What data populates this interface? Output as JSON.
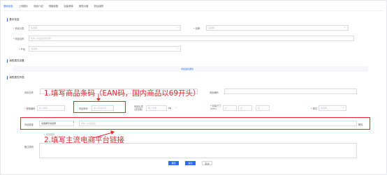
{
  "tabs": [
    "基础信息",
    "上传图片",
    "商品介绍",
    "规格参数",
    "包装清单",
    "销售价格",
    "售后保障"
  ],
  "sections": {
    "basic": "基本信息",
    "sales_attr": "销售属性设置",
    "sales_list": "销售属性列表"
  },
  "basic": {
    "category_label": "商品分类",
    "category_placeholder": "请选择",
    "brand_label": "品牌",
    "brand_placeholder": "请选择",
    "name_label": "商品名称",
    "name_placeholder": "请输入商品名称(标题)",
    "origin_label": "产地",
    "origin_placeholder": "请选择"
  },
  "sales_attr": {
    "add_link": "添加销售属性"
  },
  "sales_list": {
    "product_name_label": "商品名称",
    "product_code_label": "商品编码",
    "spec_code_label": "规格编码",
    "spec_code_placeholder": "输入编码",
    "barcode_label": "商品条码",
    "barcode_placeholder": "输入商品条码",
    "weight_label": "商品毛重(含包装)",
    "weight_placeholder": "输入毛重",
    "weight_unit": "kg",
    "dims_label": "包装尺寸(mm)",
    "dims_l": "长",
    "dims_w": "宽",
    "dims_h": "高",
    "unit_label": "单位",
    "unit_placeholder": "请选择",
    "link_label": "商品链接",
    "platform_value": "请选择平台名称",
    "link_placeholder": "请输入商品链接",
    "delete": "删除",
    "add_link": "+ 添加链接",
    "remark_label": "备注说明"
  },
  "annotations": {
    "barcode": "1.填写商品条码（EAN码，国内商品以69开头）",
    "link": "2.填写主流电商平台链接"
  },
  "footer": {
    "save": "保存",
    "submit": "提交",
    "cancel": "取消"
  },
  "colors": {
    "accent": "#2d6cf0",
    "annotation_red": "#e8262b"
  }
}
